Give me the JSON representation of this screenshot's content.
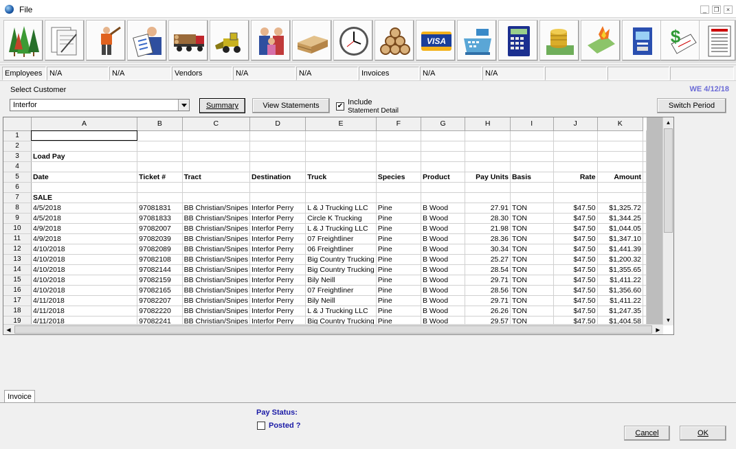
{
  "window": {
    "menu_file": "File",
    "min_symbol": "_",
    "restore_symbol": "❐",
    "close_symbol": "×"
  },
  "toolbar": {
    "icons": [
      "trees-icon",
      "documents-icon",
      "logger-icon",
      "employee-clipboard-icon",
      "log-truck-icon",
      "loader-icon",
      "family-icon",
      "lumber-stack-icon",
      "clock-icon",
      "logs-icon",
      "visa-card-icon",
      "cash-register-icon",
      "calculator-icon",
      "coins-icon",
      "burning-money-icon",
      "atm-icon",
      "dollar-check-icon",
      "report-icon"
    ]
  },
  "summary_bar": [
    {
      "label": "Employees"
    },
    {
      "label": "N/A"
    },
    {
      "label": "N/A"
    },
    {
      "label": "Vendors"
    },
    {
      "label": "N/A"
    },
    {
      "label": "N/A"
    },
    {
      "label": "Invoices"
    },
    {
      "label": "N/A"
    },
    {
      "label": "N/A"
    },
    {
      "label": ""
    },
    {
      "label": ""
    },
    {
      "label": ""
    }
  ],
  "customer": {
    "label": "Select Customer",
    "selected": "Interfor"
  },
  "buttons": {
    "summary": "Summary",
    "view_statements": "View Statements",
    "include_line1": "Include",
    "include_line2": "Statement Detail",
    "include_checked": "✔",
    "switch_period": "Switch Period",
    "cancel": "Cancel",
    "ok": "OK"
  },
  "week_ending": "WE 4/12/18",
  "sheet": {
    "columns": [
      "A",
      "B",
      "C",
      "D",
      "E",
      "F",
      "G",
      "H",
      "I",
      "J",
      "K"
    ],
    "rows": [
      {
        "n": "1",
        "c": [
          "",
          "",
          "",
          "",
          "",
          "",
          "",
          "",
          "",
          "",
          ""
        ]
      },
      {
        "n": "2",
        "c": [
          "",
          "",
          "",
          "",
          "",
          "",
          "",
          "",
          "",
          "",
          ""
        ]
      },
      {
        "n": "3",
        "c": [
          "Load Pay",
          "",
          "",
          "",
          "",
          "",
          "",
          "",
          "",
          "",
          ""
        ]
      },
      {
        "n": "4",
        "c": [
          "",
          "",
          "",
          "",
          "",
          "",
          "",
          "",
          "",
          "",
          ""
        ]
      },
      {
        "n": "5",
        "c": [
          "Date",
          "Ticket #",
          "Tract",
          "Destination",
          "Truck",
          "Species",
          "Product",
          "Pay Units",
          "Basis",
          "Rate",
          "Amount"
        ]
      },
      {
        "n": "6",
        "c": [
          "",
          "",
          "",
          "",
          "",
          "",
          "",
          "",
          "",
          "",
          ""
        ]
      },
      {
        "n": "7",
        "c": [
          "SALE",
          "",
          "",
          "",
          "",
          "",
          "",
          "",
          "",
          "",
          ""
        ]
      },
      {
        "n": "8",
        "c": [
          "4/5/2018",
          "97081831",
          "BB Christian/Snipes",
          "Interfor Perry",
          "L & J Trucking LLC",
          "Pine",
          "B Wood",
          "27.91",
          "TON",
          "$47.50",
          "$1,325.72"
        ]
      },
      {
        "n": "9",
        "c": [
          "4/5/2018",
          "97081833",
          "BB Christian/Snipes",
          "Interfor Perry",
          "Circle K Trucking",
          "Pine",
          "B Wood",
          "28.30",
          "TON",
          "$47.50",
          "$1,344.25"
        ]
      },
      {
        "n": "10",
        "c": [
          "4/9/2018",
          "97082007",
          "BB Christian/Snipes",
          "Interfor Perry",
          "L & J Trucking LLC",
          "Pine",
          "B Wood",
          "21.98",
          "TON",
          "$47.50",
          "$1,044.05"
        ]
      },
      {
        "n": "11",
        "c": [
          "4/9/2018",
          "97082039",
          "BB Christian/Snipes",
          "Interfor Perry",
          "07 Freightliner",
          "Pine",
          "B Wood",
          "28.36",
          "TON",
          "$47.50",
          "$1,347.10"
        ]
      },
      {
        "n": "12",
        "c": [
          "4/10/2018",
          "97082089",
          "BB Christian/Snipes",
          "Interfor Perry",
          "06 Freightliner",
          "Pine",
          "B Wood",
          "30.34",
          "TON",
          "$47.50",
          "$1,441.39"
        ]
      },
      {
        "n": "13",
        "c": [
          "4/10/2018",
          "97082108",
          "BB Christian/Snipes",
          "Interfor Perry",
          "Big Country Trucking",
          "Pine",
          "B Wood",
          "25.27",
          "TON",
          "$47.50",
          "$1,200.32"
        ]
      },
      {
        "n": "14",
        "c": [
          "4/10/2018",
          "97082144",
          "BB Christian/Snipes",
          "Interfor Perry",
          "Big Country Trucking",
          "Pine",
          "B Wood",
          "28.54",
          "TON",
          "$47.50",
          "$1,355.65"
        ]
      },
      {
        "n": "15",
        "c": [
          "4/10/2018",
          "97082159",
          "BB Christian/Snipes",
          "Interfor Perry",
          "Bily Neill",
          "Pine",
          "B Wood",
          "29.71",
          "TON",
          "$47.50",
          "$1,411.22"
        ]
      },
      {
        "n": "16",
        "c": [
          "4/10/2018",
          "97082165",
          "BB Christian/Snipes",
          "Interfor Perry",
          "07 Freightliner",
          "Pine",
          "B Wood",
          "28.56",
          "TON",
          "$47.50",
          "$1,356.60"
        ]
      },
      {
        "n": "17",
        "c": [
          "4/11/2018",
          "97082207",
          "BB Christian/Snipes",
          "Interfor Perry",
          "Bily Neill",
          "Pine",
          "B Wood",
          "29.71",
          "TON",
          "$47.50",
          "$1,411.22"
        ]
      },
      {
        "n": "18",
        "c": [
          "4/11/2018",
          "97082220",
          "BB Christian/Snipes",
          "Interfor Perry",
          "L & J Trucking LLC",
          "Pine",
          "B Wood",
          "26.26",
          "TON",
          "$47.50",
          "$1,247.35"
        ]
      },
      {
        "n": "19",
        "c": [
          "4/11/2018",
          "97082241",
          "BB Christian/Snipes",
          "Interfor Perry",
          "Big Country Trucking",
          "Pine",
          "B Wood",
          "29.57",
          "TON",
          "$47.50",
          "$1,404.58"
        ]
      }
    ]
  },
  "tab_invoice": "Invoice",
  "pay_status": {
    "label": "Pay Status:",
    "posted_label": "Posted ?"
  }
}
